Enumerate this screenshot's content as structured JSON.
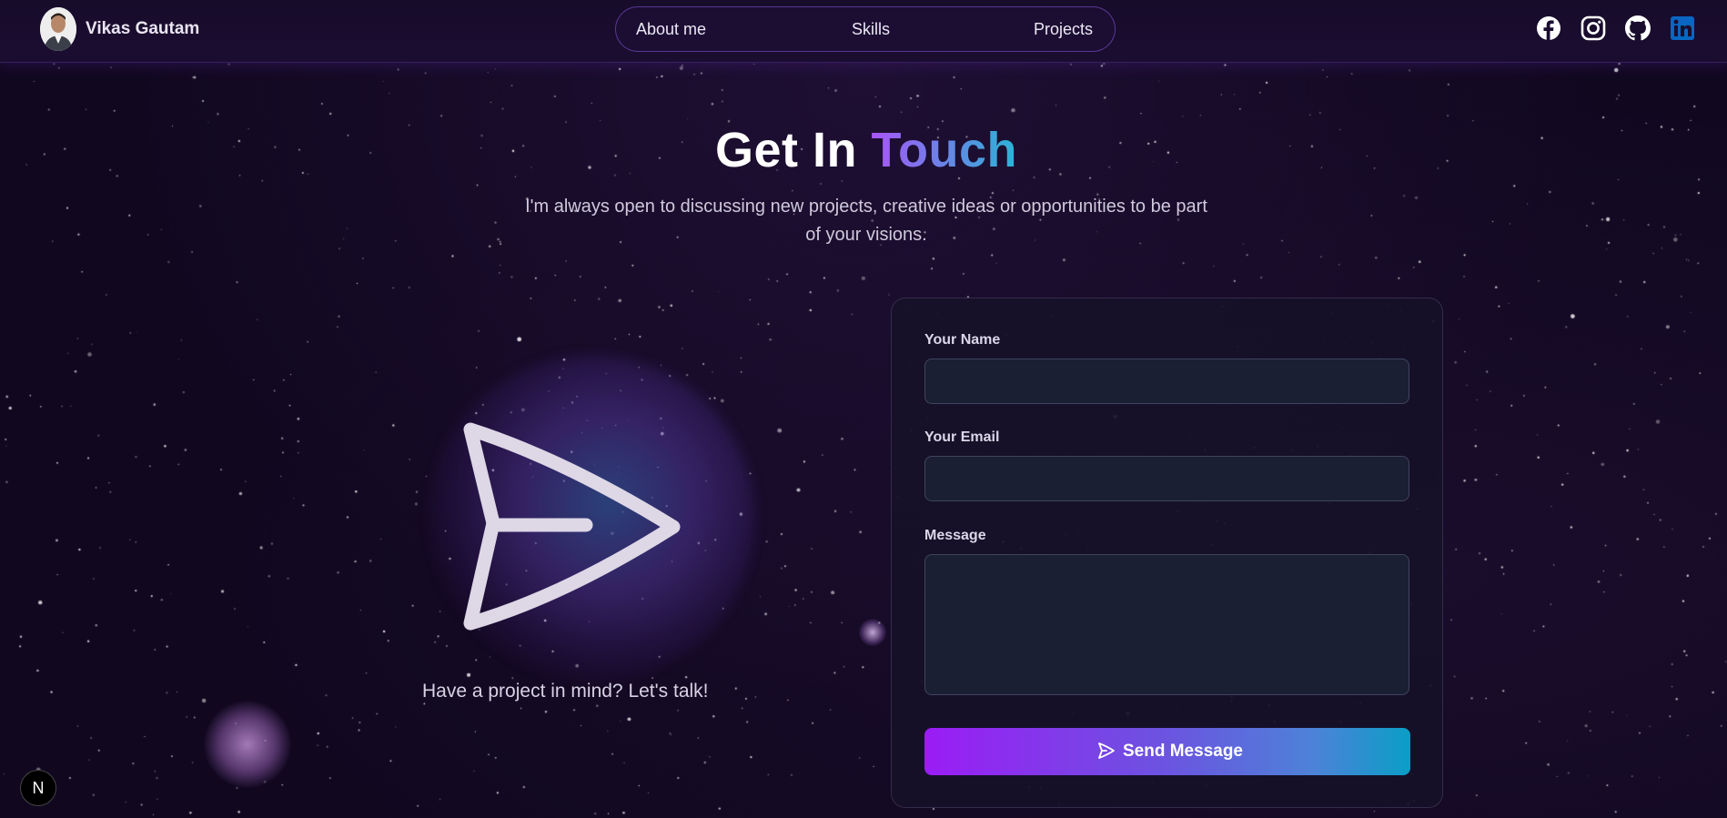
{
  "header": {
    "brand": "Vikas Gautam",
    "nav": [
      "About me",
      "Skills",
      "Projects"
    ],
    "socials": [
      "facebook-icon",
      "instagram-icon",
      "github-icon",
      "linkedin-icon"
    ]
  },
  "hero": {
    "title_main": "Get In ",
    "title_accent": "Touch",
    "subtitle": "I'm always open to discussing new projects, creative ideas or opportunities to be part of your visions.",
    "tagline": "Have a project in mind? Let's talk!"
  },
  "form": {
    "name_label": "Your Name",
    "name_value": "",
    "email_label": "Your Email",
    "email_value": "",
    "message_label": "Message",
    "message_value": "",
    "submit_label": "Send Message"
  },
  "badge": "N",
  "colors": {
    "background": "#110820",
    "accent_start": "#a855f7",
    "accent_end": "#2ab4d6",
    "linkedin": "#0a66c2"
  }
}
